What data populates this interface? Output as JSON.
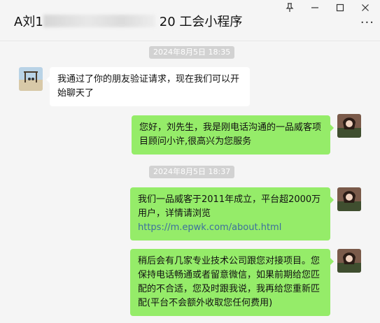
{
  "window": {
    "title_prefix": "A刘1",
    "title_suffix": "20 工会小程序",
    "pin_icon": "pin-icon",
    "minimize_icon": "minimize-icon",
    "maximize_icon": "maximize-icon",
    "close_icon": "close-icon",
    "more_label": "···"
  },
  "messages": [
    {
      "timestamp": "2024年8月5日 18:35"
    },
    {
      "side": "left",
      "text": "我通过了你的朋友验证请求，现在我们可以开始聊天了"
    },
    {
      "side": "right",
      "text": "您好，刘先生，我是刚电话沟通的一品威客项目顾问小许,很高兴为您服务"
    },
    {
      "timestamp": "2024年8月5日 18:37"
    },
    {
      "side": "right",
      "text": "我们一品威客于2011年成立，平台超2000万用户，详情请浏览",
      "link": "https://m.epwk.com/about.html"
    },
    {
      "side": "right",
      "text": "稍后会有几家专业技术公司跟您对接项目。您保持电话畅通或者留意微信，如果前期给您匹配的不合适，您及时跟我说，我再给您重新匹配(平台不会额外收取您任何费用)"
    }
  ]
}
